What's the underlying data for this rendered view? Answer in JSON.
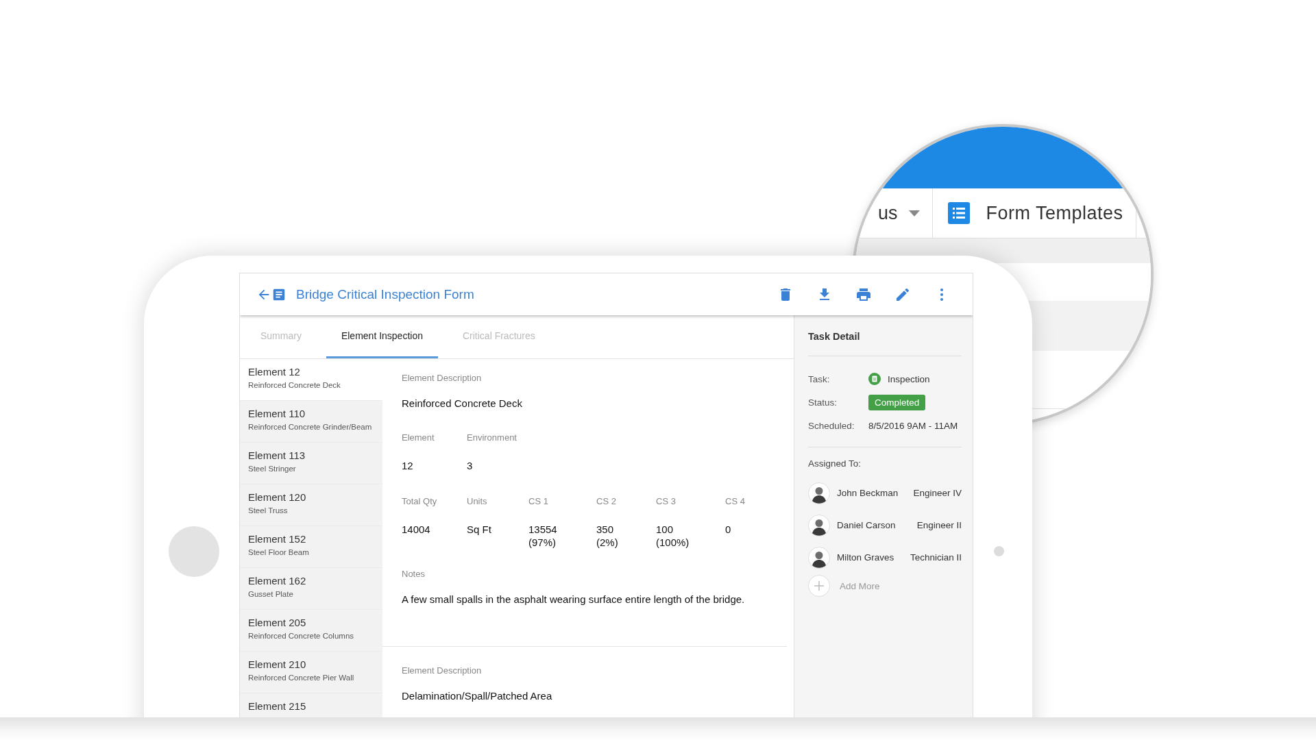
{
  "magnifier": {
    "menu_text": "us",
    "item_label": "Form Templates"
  },
  "header": {
    "title": "Bridge Critical Inspection Form"
  },
  "tabs": [
    {
      "label": "Summary",
      "selected": false
    },
    {
      "label": "Element Inspection",
      "selected": true
    },
    {
      "label": "Critical Fractures",
      "selected": false
    }
  ],
  "elements": [
    {
      "title": "Element 12",
      "subtitle": "Reinforced Concrete Deck",
      "selected": true
    },
    {
      "title": "Element 110",
      "subtitle": "Reinforced Concrete Grinder/Beam",
      "selected": false
    },
    {
      "title": "Element 113",
      "subtitle": "Steel Stringer",
      "selected": false
    },
    {
      "title": "Element 120",
      "subtitle": "Steel Truss",
      "selected": false
    },
    {
      "title": "Element 152",
      "subtitle": "Steel Floor Beam",
      "selected": false
    },
    {
      "title": "Element 162",
      "subtitle": "Gusset Plate",
      "selected": false
    },
    {
      "title": "Element 205",
      "subtitle": "Reinforced Concrete Columns",
      "selected": false
    },
    {
      "title": "Element 210",
      "subtitle": "Reinforced Concrete Pier Wall",
      "selected": false
    },
    {
      "title": "Element 215",
      "selected": false
    }
  ],
  "detail": {
    "description_label": "Element Description",
    "description": "Reinforced Concrete Deck",
    "id_fields": [
      {
        "label": "Element",
        "value": "12"
      },
      {
        "label": "Environment",
        "value": "3"
      }
    ],
    "quantity_fields": [
      {
        "label": "Total Qty",
        "value": "14004"
      },
      {
        "label": "Units",
        "value": "Sq Ft"
      },
      {
        "label": "CS 1",
        "value": "13554",
        "share": "(97%)"
      },
      {
        "label": "CS 2",
        "value": "350",
        "share": "(2%)"
      },
      {
        "label": "CS 3",
        "value": "100",
        "share": "(100%)"
      },
      {
        "label": "CS 4",
        "value": "0"
      }
    ],
    "notes_label": "Notes",
    "notes": "A few small spalls in the asphalt wearing surface entire length of the bridge."
  },
  "next_detail": {
    "description_label": "Element Description",
    "description": "Delamination/Spall/Patched Area"
  },
  "task_detail": {
    "title": "Task Detail",
    "rows": [
      {
        "label": "Task:",
        "value": "Inspection",
        "kind": "task"
      },
      {
        "label": "Status:",
        "value": "Completed",
        "kind": "status"
      },
      {
        "label": "Scheduled:",
        "value": "8/5/2016 9AM - 11AM",
        "kind": "text"
      }
    ],
    "assigned_label": "Assigned To:",
    "assignees": [
      {
        "name": "John Beckman",
        "role": "Engineer IV"
      },
      {
        "name": "Daniel Carson",
        "role": "Engineer II"
      },
      {
        "name": "Milton Graves",
        "role": "Technician II"
      }
    ],
    "add_label": "Add More"
  }
}
